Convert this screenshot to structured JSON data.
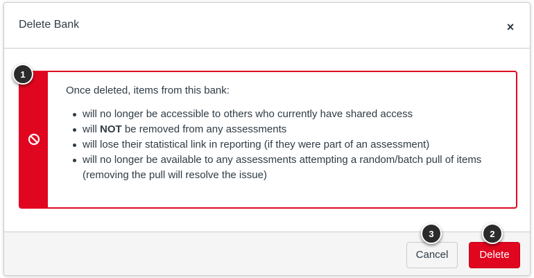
{
  "dialog": {
    "title": "Delete Bank",
    "close_icon": "×"
  },
  "alert": {
    "icon": "prohibit-icon",
    "color": "#e0061f",
    "intro": "Once deleted, items from this bank:",
    "items": [
      {
        "text": "will no longer be accessible to others who currently have shared access"
      },
      {
        "pre": "will ",
        "strong": "NOT",
        "post": " be removed from any assessments"
      },
      {
        "text": "will lose their statistical link in reporting (if they were part of an assessment)"
      },
      {
        "text": "will no longer be available to any assessments attempting a random/batch pull of items (removing the pull will resolve the issue)"
      }
    ]
  },
  "footer": {
    "cancel_label": "Cancel",
    "delete_label": "Delete"
  },
  "callouts": [
    "1",
    "2",
    "3"
  ]
}
